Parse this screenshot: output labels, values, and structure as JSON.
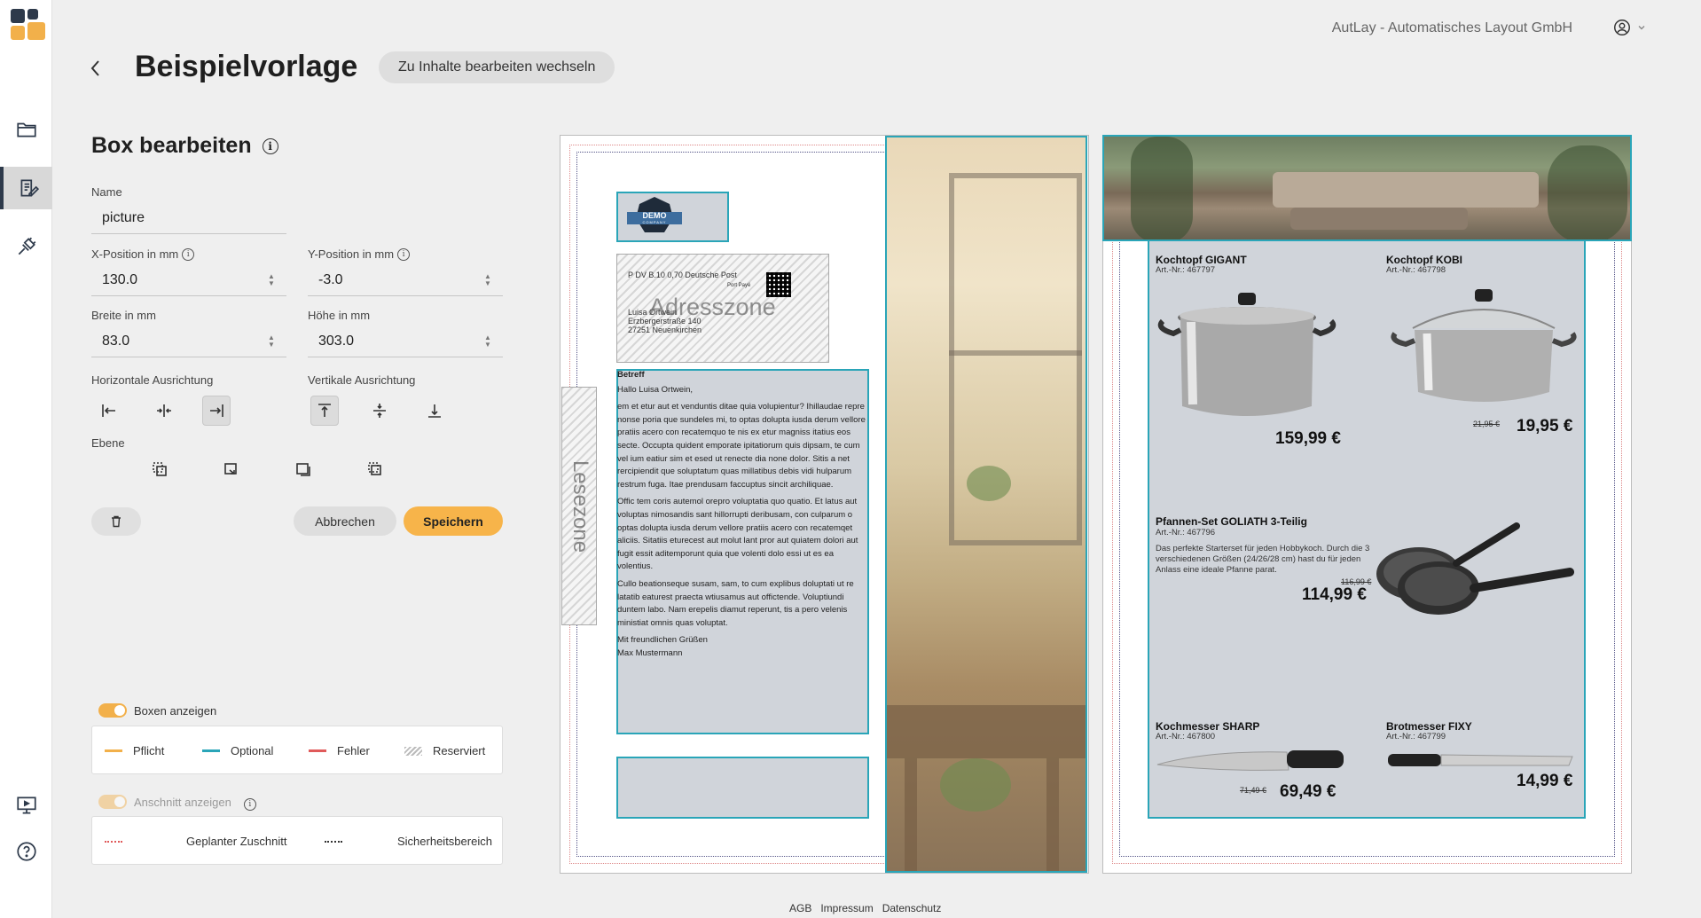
{
  "header": {
    "company": "AutLay - Automatisches Layout GmbH",
    "title": "Beispielvorlage",
    "switch_label": "Zu Inhalte bearbeiten wechseln"
  },
  "panel": {
    "title": "Box bearbeiten",
    "name_label": "Name",
    "name_value": "picture",
    "x_label": "X-Position in mm",
    "x_value": "130.0",
    "y_label": "Y-Position in mm",
    "y_value": "-3.0",
    "w_label": "Breite in mm",
    "w_value": "83.0",
    "h_label": "Höhe in mm",
    "h_value": "303.0",
    "h_align_label": "Horizontale Ausrichtung",
    "v_align_label": "Vertikale Ausrichtung",
    "layer_label": "Ebene",
    "cancel_label": "Abbrechen",
    "save_label": "Speichern"
  },
  "legend": {
    "show_boxes": "Boxen anzeigen",
    "items": [
      "Pflicht",
      "Optional",
      "Fehler",
      "Reserviert"
    ],
    "colors": {
      "pflicht": "#f2b04a",
      "optional": "#2aa5b8",
      "fehler": "#e05a5a"
    },
    "show_bleed": "Anschnitt anzeigen",
    "planned_cut": "Geplanter Zuschnitt",
    "safety_area": "Sicherheitsbereich"
  },
  "canvas": {
    "demo_logo": "DEMO",
    "demo_sub": "COMPANY",
    "address_zone": "Adresszone",
    "read_zone": "Lesezone",
    "postage_line1": "P  DV  B.10  0,70  Deutsche Post",
    "postage_small": "Port Payé",
    "addr_name": "Luisa Ortwein",
    "addr_street": "Erzbergerstraße 140",
    "addr_city": "27251 Neuenkirchen",
    "letter": {
      "subject": "Betreff",
      "greeting": "Hallo Luisa Ortwein,",
      "p1": "em et etur aut et venduntis ditae quia volupientur? Ihillaudae repre nonse poria que sundeles mi, to optas dolupta iusda derum vellore pratiis acero con recatemquo te nis ex etur magniss itatius eos secte. Occupta quident emporate ipitatiorum quis dipsam, te cum vel ium eatiur sim et esed ut renecte dia none dolor. Sitis a net rercipiendit que soluptatum quas millatibus debis vidi hulparum restrum fuga. Itae prendusam faccuptus sincit archiliquae.",
      "p2": "Offic tem coris autemol orepro voluptatia quo quatio. Et latus aut voluptas nimosandis sant hillorrupti deribusam, con culparum o optas dolupta iusda derum vellore pratiis acero con recatemqet aliciis. Sitatiis eturecest aut molut lant pror aut quiatem dolori aut fugit essit aditemporunt quia que volenti dolo essi ut es ea volentius.",
      "p3": "Cullo beationseque susam, sam, to cum explibus doluptati ut re latatib eaturest praecta wtiusamus aut offictende. Voluptiundi duntem labo. Nam erepelis diamut reperunt, tis a pero velenis ministiat omnis quas voluptat.",
      "closing": "Mit freundlichen Grüßen",
      "sender": "Max Mustermann"
    },
    "products": [
      {
        "name": "Kochtopf GIGANT",
        "art": "Art.-Nr.: 467797",
        "price": "159,99 €",
        "old": ""
      },
      {
        "name": "Kochtopf KOBI",
        "art": "Art.-Nr.: 467798",
        "price": "19,95 €",
        "old": "21,95 €"
      },
      {
        "name": "Pfannen-Set GOLIATH 3-Teilig",
        "art": "Art.-Nr.: 467796",
        "price": "114,99 €",
        "old": "116,99 €",
        "desc": "Das perfekte Starterset für jeden Hobbykoch. Durch die 3 verschiedenen Größen (24/26/28 cm) hast du für jeden Anlass eine ideale Pfanne parat."
      },
      {
        "name": "Kochmesser SHARP",
        "art": "Art.-Nr.: 467800",
        "price": "69,49 €",
        "old": "71,49 €"
      },
      {
        "name": "Brotmesser FIXY",
        "art": "Art.-Nr.: 467799",
        "price": "14,99 €",
        "old": ""
      }
    ]
  },
  "footer": {
    "links": [
      "AGB",
      "Impressum",
      "Datenschutz"
    ]
  }
}
